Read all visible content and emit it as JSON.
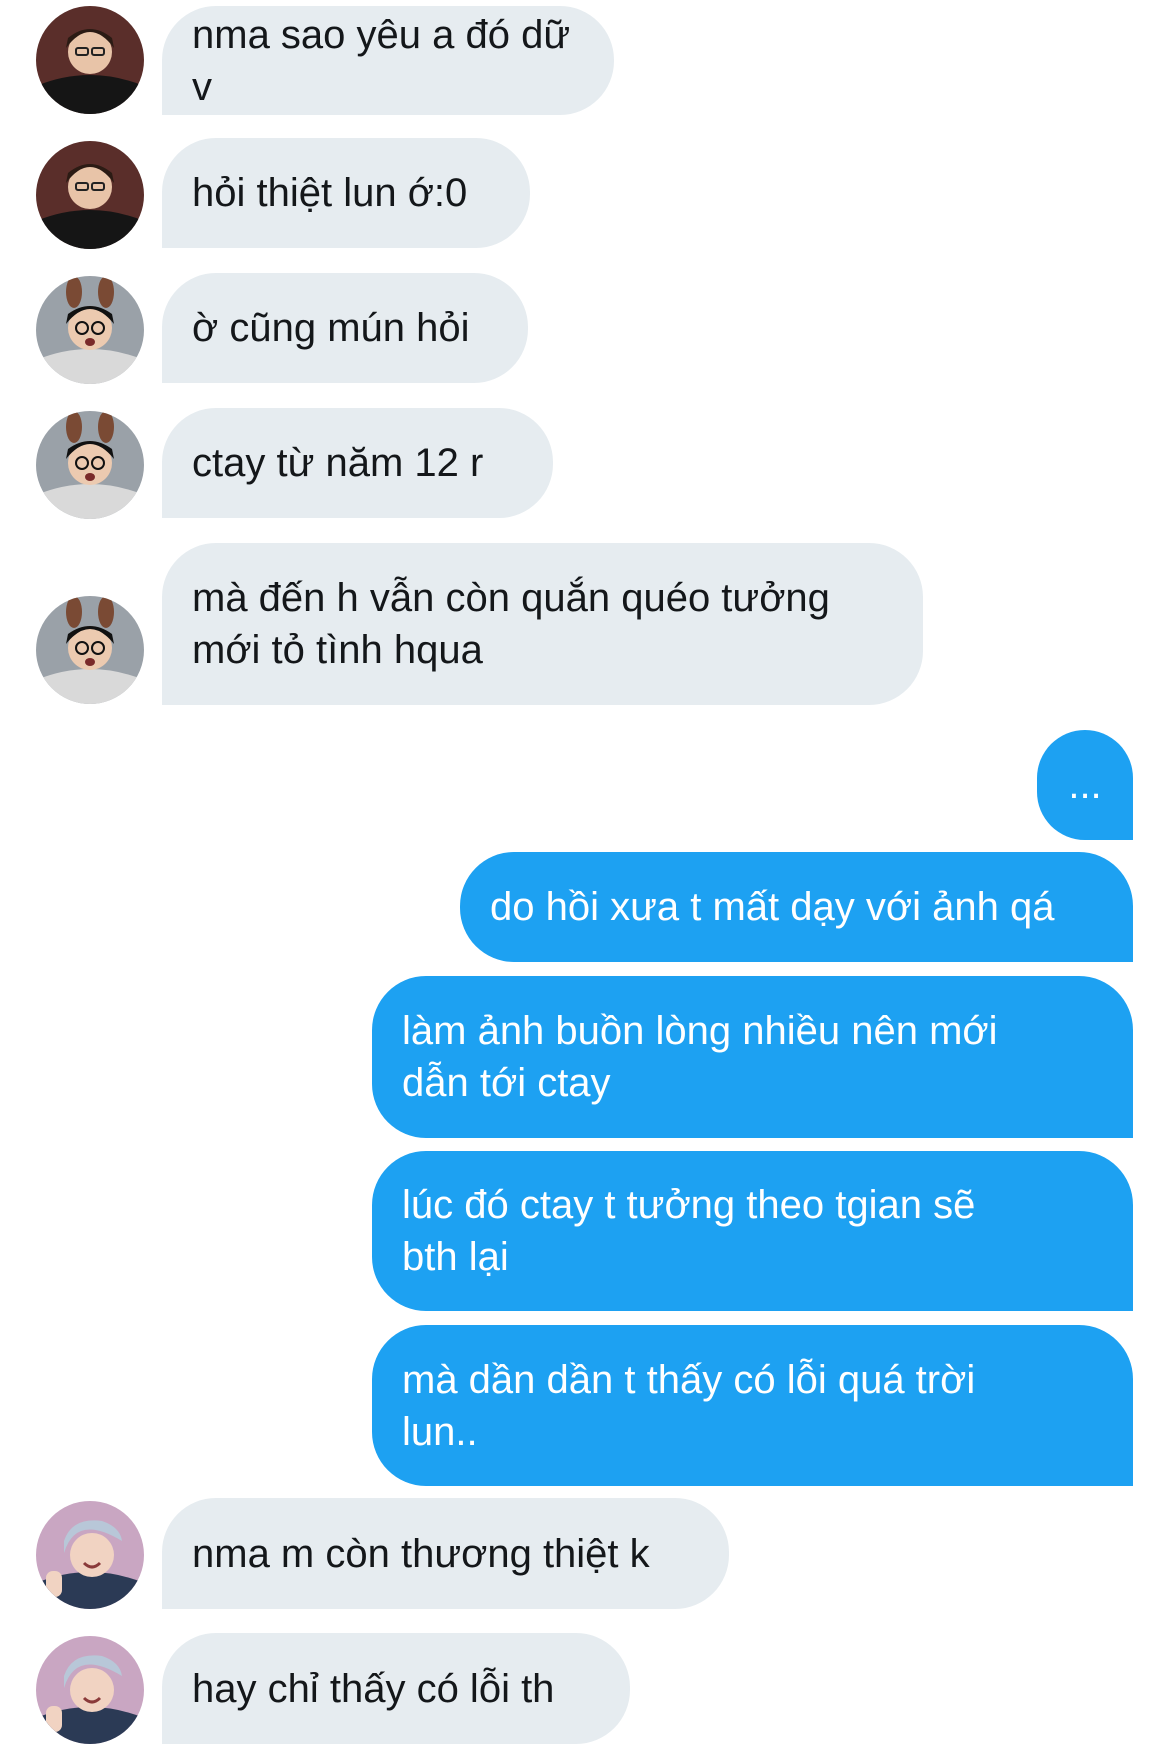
{
  "conversation": {
    "messages": [
      {
        "side": "in",
        "avatar": "avatar-a",
        "text": "nma sao yêu a đó dữ v"
      },
      {
        "side": "in",
        "avatar": "avatar-a",
        "text": "hỏi thiệt lun ớ:0"
      },
      {
        "side": "in",
        "avatar": "avatar-b",
        "text": "ờ cũng mún hỏi"
      },
      {
        "side": "in",
        "avatar": "avatar-b",
        "text": "ctay từ năm 12 r"
      },
      {
        "side": "in",
        "avatar": "avatar-b",
        "text": "mà đến h vẫn còn quắn quéo tưởng\nmới tỏ tình hqua"
      },
      {
        "side": "out",
        "text": "..."
      },
      {
        "side": "out",
        "text": "do hồi xưa t mất dạy với ảnh qá"
      },
      {
        "side": "out",
        "text": "làm ảnh buồn lòng nhiều nên mới\ndẫn tới ctay"
      },
      {
        "side": "out",
        "text": "lúc đó ctay t tưởng theo tgian sẽ\nbth lại"
      },
      {
        "side": "out",
        "text": "mà dần dần t thấy có lỗi quá trời\nlun.."
      },
      {
        "side": "in",
        "avatar": "avatar-c",
        "text": "nma m còn thương thiệt k"
      },
      {
        "side": "in",
        "avatar": "avatar-c",
        "text": "hay chỉ thấy có lỗi th"
      }
    ]
  },
  "colors": {
    "incoming_bubble": "#e6ecf0",
    "incoming_text": "#14171a",
    "outgoing_bubble": "#1da1f2",
    "outgoing_text": "#ffffff"
  }
}
